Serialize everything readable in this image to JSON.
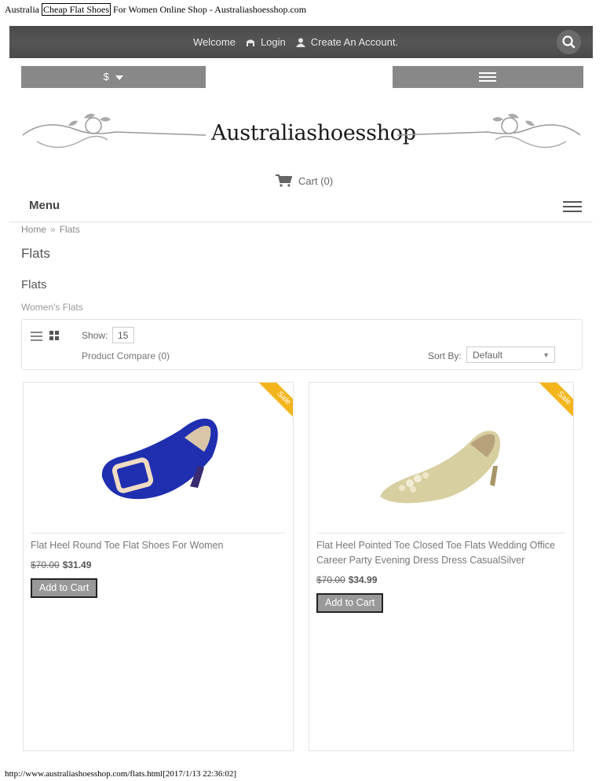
{
  "page_title": {
    "before": "Australia",
    "highlight": "Cheap Flat Shoes",
    "after": "For Women Online Shop - Australiashoesshop.com"
  },
  "topbar": {
    "welcome": "Welcome",
    "login": "Login",
    "create_account": "Create An Account."
  },
  "currency": {
    "label": "$"
  },
  "logo": {
    "text": "Australiashoesshop"
  },
  "cart": {
    "label": "Cart",
    "count": "(0)"
  },
  "menu": {
    "label": "Menu"
  },
  "breadcrumb": {
    "home": "Home",
    "sep": "»",
    "current": "Flats"
  },
  "heading": "Flats",
  "category": {
    "title": "Flats",
    "description": "Women's Flats"
  },
  "toolbar": {
    "show_label": "Show:",
    "show_value": "15",
    "compare": "Product Compare (0)",
    "sort_label": "Sort By:",
    "sort_value": "Default"
  },
  "products": [
    {
      "name": "Flat Heel Round Toe Flat Shoes For Women",
      "old_price": "$70.00",
      "price": "$31.49",
      "badge": "Sale",
      "button": "Add to Cart"
    },
    {
      "name": "Flat Heel Pointed Toe Closed Toe Flats Wedding Office Career Party Evening Dress Dress CasualSilver",
      "old_price": "$70.00",
      "price": "$34.99",
      "badge": "Sale",
      "button": "Add to Cart"
    }
  ],
  "footer_url": "http://www.australiashoesshop.com/flats.html[2017/1/13 22:36:02]",
  "colors": {
    "topbar": "#4f4f4f",
    "bar": "#888888",
    "sale": "#f4b51c",
    "shoe1": "#1f2fb0",
    "shoe2": "#d8cfa0"
  }
}
